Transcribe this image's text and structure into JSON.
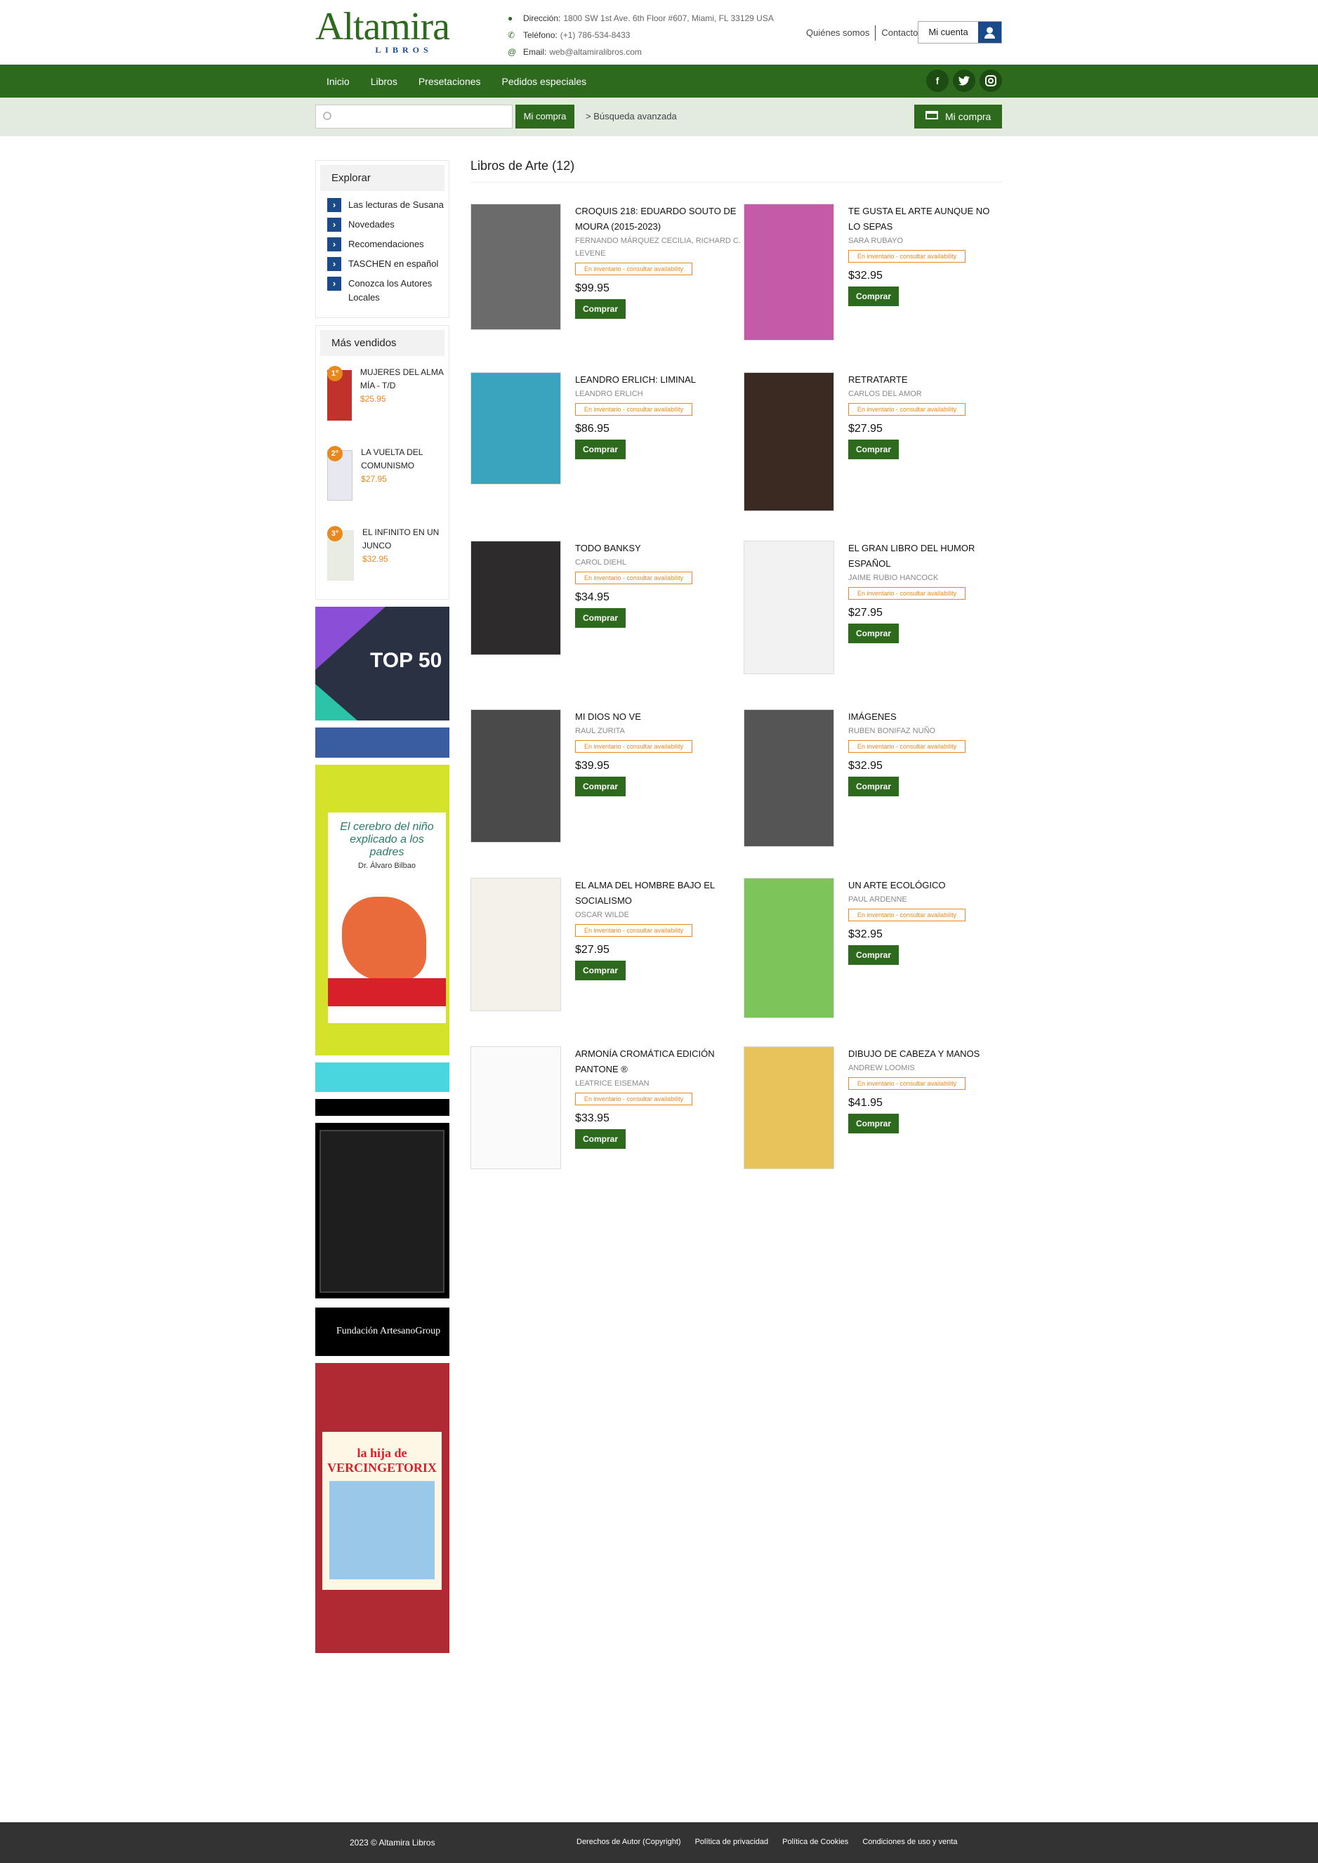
{
  "brand": {
    "name": "Altamira",
    "sub": "LIBROS"
  },
  "contact": {
    "address_label": "Dirección:",
    "address": "1800 SW 1st Ave. 6th Floor #607, Miami, FL 33129 USA",
    "phone_label": "Teléfono:",
    "phone": "(+1) 786-534-8433",
    "email_label": "Email:",
    "email": "web@altamiralibros.com"
  },
  "toplinks": {
    "about": "Quiénes somos",
    "contact": "Contacto",
    "account": "Mi cuenta"
  },
  "nav": [
    "Inicio",
    "Libros",
    "Presetaciones",
    "Pedidos especiales"
  ],
  "social": [
    "f",
    "t",
    "ig"
  ],
  "search": {
    "placeholder": "",
    "button": "Mi compra",
    "advanced": "> Búsqueda avanzada",
    "cart": "Mi compra"
  },
  "explore": {
    "title": "Explorar",
    "items": [
      "Las lecturas de Susana",
      "Novedades",
      "Recomendaciones",
      "TASCHEN en español",
      "Conozca los Autores Locales"
    ]
  },
  "bestsellers": {
    "title": "Más vendidos",
    "items": [
      {
        "rank": "1°",
        "title": "MUJERES DEL ALMA MÍA - T/D",
        "price": "$25.95"
      },
      {
        "rank": "2°",
        "title": "LA VUELTA DEL COMUNISMO",
        "price": "$27.95"
      },
      {
        "rank": "3°",
        "title": "EL INFINITO EN UN JUNCO",
        "price": "$32.95"
      }
    ]
  },
  "banners": {
    "top50": "TOP 50",
    "brain_title": "El cerebro del niño explicado a los padres",
    "brain_author": "Dr. Álvaro Bilbao",
    "fundacion": "Fundación ArtesanoGroup",
    "asterix": "la hija de VERCINGETORIX"
  },
  "main": {
    "heading": "Libros de Arte (12)",
    "stock": "En inventario - consultar availability",
    "buy": "Comprar",
    "books": [
      {
        "title": "CROQUIS 218: EDUARDO SOUTO DE MOURA (2015-2023)",
        "author": "FERNANDO MÁRQUEZ CECILIA, RICHARD C. LEVENE",
        "price": "$99.95",
        "color": "#6b6b6b"
      },
      {
        "title": "TE GUSTA EL ARTE AUNQUE NO LO SEPAS",
        "author": "SARA RUBAYO",
        "price": "$32.95",
        "color": "#c55aa8"
      },
      {
        "title": "LEANDRO ERLICH: LIMINAL",
        "author": "LEANDRO ERLICH",
        "price": "$86.95",
        "color": "#3aa3bd"
      },
      {
        "title": "RETRATARTE",
        "author": "CARLOS DEL AMOR",
        "price": "$27.95",
        "color": "#3a2a22"
      },
      {
        "title": "TODO BANKSY",
        "author": "CAROL DIEHL",
        "price": "$34.95",
        "color": "#2e2b2d"
      },
      {
        "title": "EL GRAN LIBRO DEL HUMOR ESPAÑOL",
        "author": "JAIME RUBIO HANCOCK",
        "price": "$27.95",
        "color": "#f2f2f2"
      },
      {
        "title": "MI DIOS NO VE",
        "author": "RAUL ZURITA",
        "price": "$39.95",
        "color": "#4a4a4a"
      },
      {
        "title": "IMÁGENES",
        "author": "RUBEN BONIFAZ NUÑO",
        "price": "$32.95",
        "color": "#555555"
      },
      {
        "title": "EL ALMA DEL HOMBRE BAJO EL SOCIALISMO",
        "author": "OSCAR WILDE",
        "price": "$27.95",
        "color": "#f4f1ea"
      },
      {
        "title": "UN ARTE ECOLÓGICO",
        "author": "PAUL ARDENNE",
        "price": "$32.95",
        "color": "#7dc45a"
      },
      {
        "title": "ARMONÍA CROMÁTICA EDICIÓN PANTONE ®",
        "author": "LEATRICE EISEMAN",
        "price": "$33.95",
        "color": "#fafafa"
      },
      {
        "title": "DIBUJO DE CABEZA Y MANOS",
        "author": "ANDREW LOOMIS",
        "price": "$41.95",
        "color": "#e8c25a"
      }
    ]
  },
  "footer": {
    "copyright": "2023 © Altamira Libros",
    "links": [
      "Derechos de Autor (Copyright)",
      "Política de privacidad",
      "Política de Cookies",
      "Condiciones de uso y venta"
    ]
  }
}
